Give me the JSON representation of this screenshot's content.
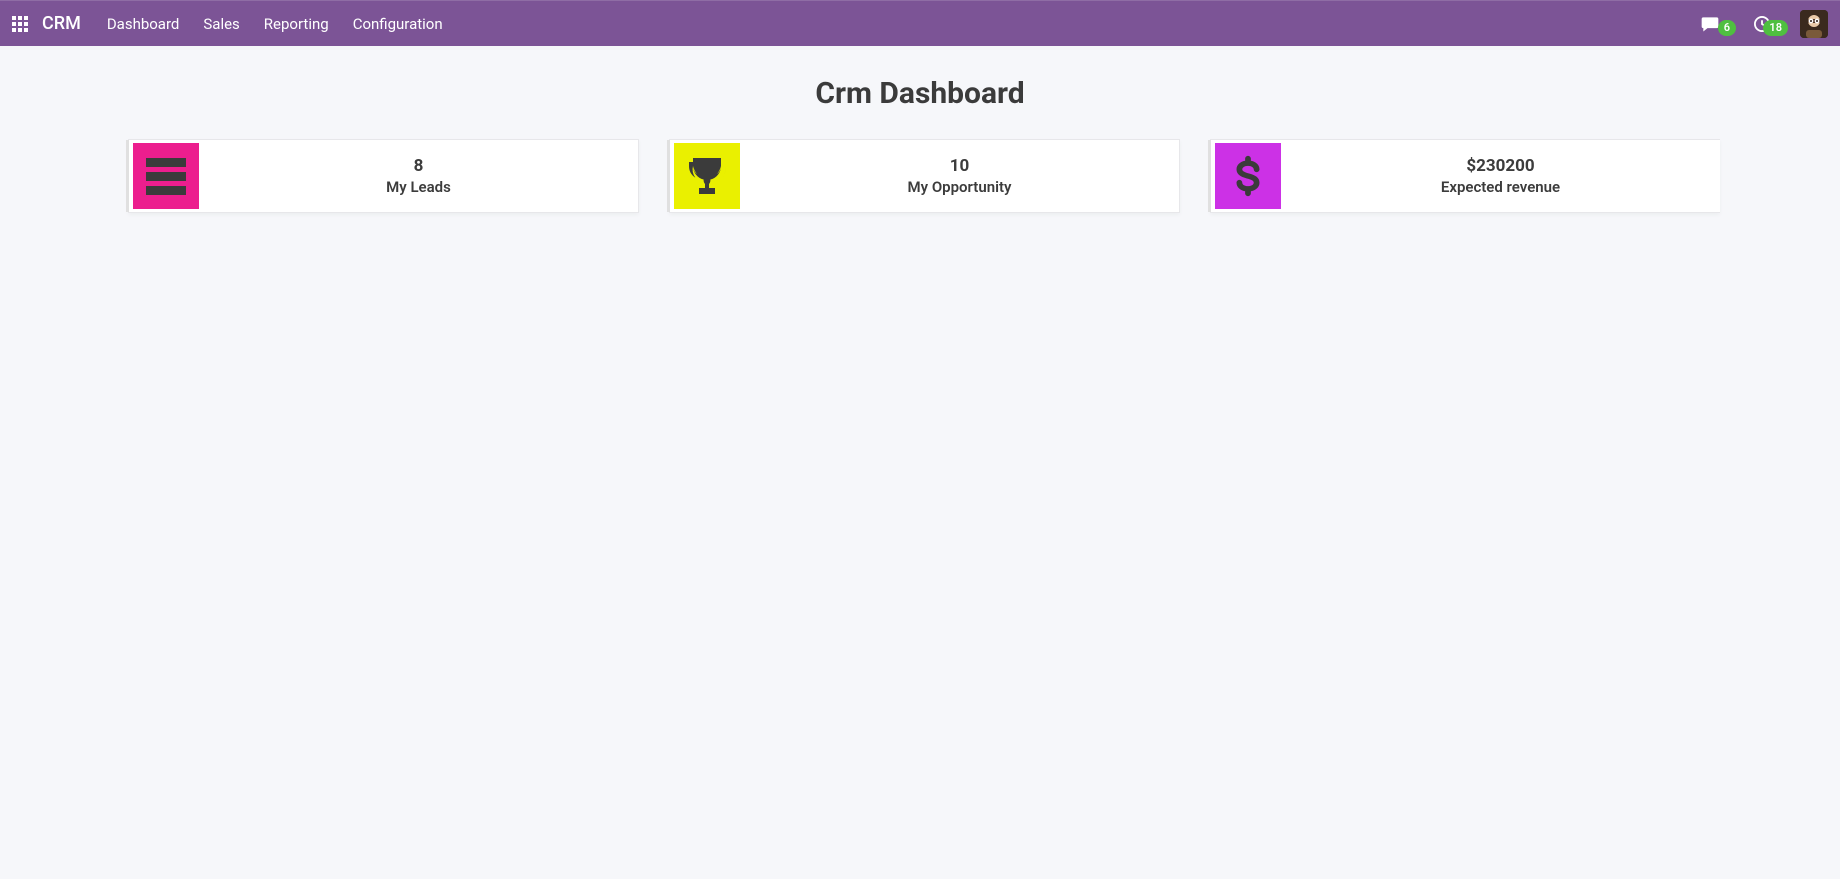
{
  "nav": {
    "brand": "CRM",
    "items": [
      "Dashboard",
      "Sales",
      "Reporting",
      "Configuration"
    ],
    "messages_badge": "6",
    "activities_badge": "18"
  },
  "page": {
    "title": "Crm Dashboard"
  },
  "cards": [
    {
      "value": "8",
      "label": "My Leads",
      "icon": "list-icon",
      "bg": "#ec1e8e"
    },
    {
      "value": "10",
      "label": "My Opportunity",
      "icon": "trophy-icon",
      "bg": "#eaf000"
    },
    {
      "value": "$230200",
      "label": "Expected revenue",
      "icon": "dollar-icon",
      "bg": "#cc31e6"
    }
  ]
}
